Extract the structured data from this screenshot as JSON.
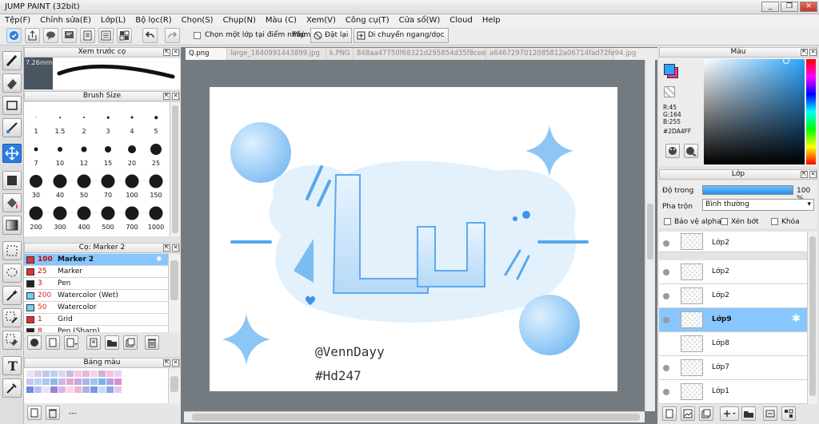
{
  "window": {
    "title": "JUMP PAINT (32bit)"
  },
  "menu": [
    "Tệp(F)",
    "Chỉnh sửa(E)",
    "Lớp(L)",
    "Bộ lọc(R)",
    "Chọn(S)",
    "Chụp(N)",
    "Màu (C)",
    "Xem(V)",
    "Công cụ(T)",
    "Cửa sổ(W)",
    "Cloud",
    "Help"
  ],
  "toolbar": {
    "checkbox_label": "Chọn một lớp tại điểm nhấp",
    "key_label": "Phím",
    "reset_label": "Đặt lại",
    "move_label": "Di chuyển ngang/dọc"
  },
  "preview": {
    "title": "Xem trước cọ",
    "size": "7.26mm"
  },
  "brush_size": {
    "title": "Brush Size",
    "sizes": [
      "1",
      "1.5",
      "2",
      "3",
      "4",
      "5",
      "7",
      "10",
      "12",
      "15",
      "20",
      "25",
      "30",
      "40",
      "50",
      "70",
      "100",
      "150",
      "200",
      "300",
      "400",
      "500",
      "700",
      "1000"
    ]
  },
  "brush_panel": {
    "title": "Cọ: Marker 2",
    "items": [
      {
        "size": "100",
        "name": "Marker 2",
        "color": "#e53030"
      },
      {
        "size": "25",
        "name": "Marker",
        "color": "#e53030"
      },
      {
        "size": "3",
        "name": "Pen",
        "color": "#222222"
      },
      {
        "size": "200",
        "name": "Watercolor (Wet)",
        "color": "#6fd0f4"
      },
      {
        "size": "50",
        "name": "Watercolor",
        "color": "#6fd0f4"
      },
      {
        "size": "1",
        "name": "Grid",
        "color": "#e53030"
      },
      {
        "size": "8",
        "name": "Pen (Sharp)",
        "color": "#222222"
      }
    ]
  },
  "palette": {
    "title": "Bảng màu",
    "footer": "---"
  },
  "tabs": [
    "Q.png",
    "large_1640991443899.jpg",
    "k.PNG",
    "848aa47750f68321d295854d35f8cee8.jpg",
    "a6467297012085812a06714fad72fe94.jpg"
  ],
  "artwork": {
    "lettering": "Lu",
    "credit": "@VennDayy",
    "hashtag": "#Hd247"
  },
  "color_panel": {
    "title": "Màu",
    "r": "R:45",
    "g": "G:164",
    "b": "B:255",
    "hex": "#2DA4FF",
    "foreground": "#2da4ff",
    "background": "#ff2ea0"
  },
  "layer_panel": {
    "title": "Lớp",
    "opacity_label": "Độ trong",
    "opacity_value": "100 %",
    "opacity": 1.0,
    "blend_label": "Pha trộn",
    "blend_value": "Bình thường",
    "protect_alpha": "Bảo vệ alpha",
    "clipping": "Xén bớt",
    "lock": "Khóa",
    "layers": [
      "Lớp2",
      "Lớp2",
      "Lớp2",
      "Lớp9",
      "Lớp8",
      "Lớp7",
      "Lớp1"
    ]
  },
  "colors": {
    "accent": "#2c7de1",
    "selection": "#87c6ff"
  }
}
